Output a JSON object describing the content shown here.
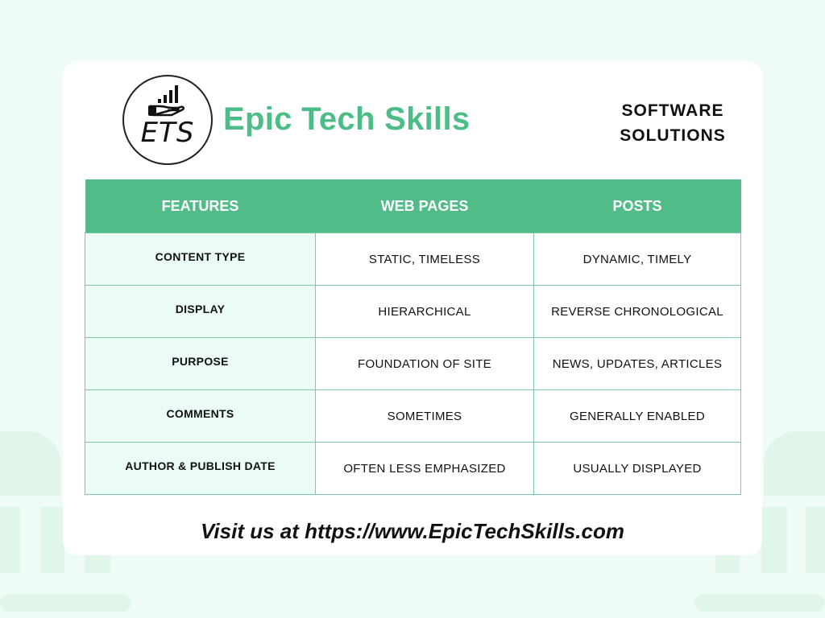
{
  "brand": {
    "logo_initials": "ETS",
    "name": "Epic Tech Skills",
    "tagline_lines": [
      "SOFTWARE",
      "SOLUTIONS"
    ],
    "accent_color": "#4dbd88"
  },
  "table": {
    "headers": [
      "FEATURES",
      "WEB PAGES",
      "POSTS"
    ],
    "rows": [
      {
        "feature": "CONTENT TYPE",
        "web_pages": "STATIC, TIMELESS",
        "posts": "DYNAMIC, TIMELY"
      },
      {
        "feature": "DISPLAY",
        "web_pages": "HIERARCHICAL",
        "posts": "REVERSE CHRONOLOGICAL"
      },
      {
        "feature": "PURPOSE",
        "web_pages": "FOUNDATION OF SITE",
        "posts": "NEWS, UPDATES, ARTICLES"
      },
      {
        "feature": "COMMENTS",
        "web_pages": "SOMETIMES",
        "posts": "GENERALLY ENABLED"
      },
      {
        "feature": "AUTHOR & PUBLISH DATE",
        "web_pages": "OFTEN LESS EMPHASIZED",
        "posts": "USUALLY DISPLAYED"
      }
    ],
    "header_color": "#52bc88",
    "feature_cell_color": "#eafcf3"
  },
  "footer": {
    "text": "Visit us at https://www.EpicTechSkills.com"
  }
}
